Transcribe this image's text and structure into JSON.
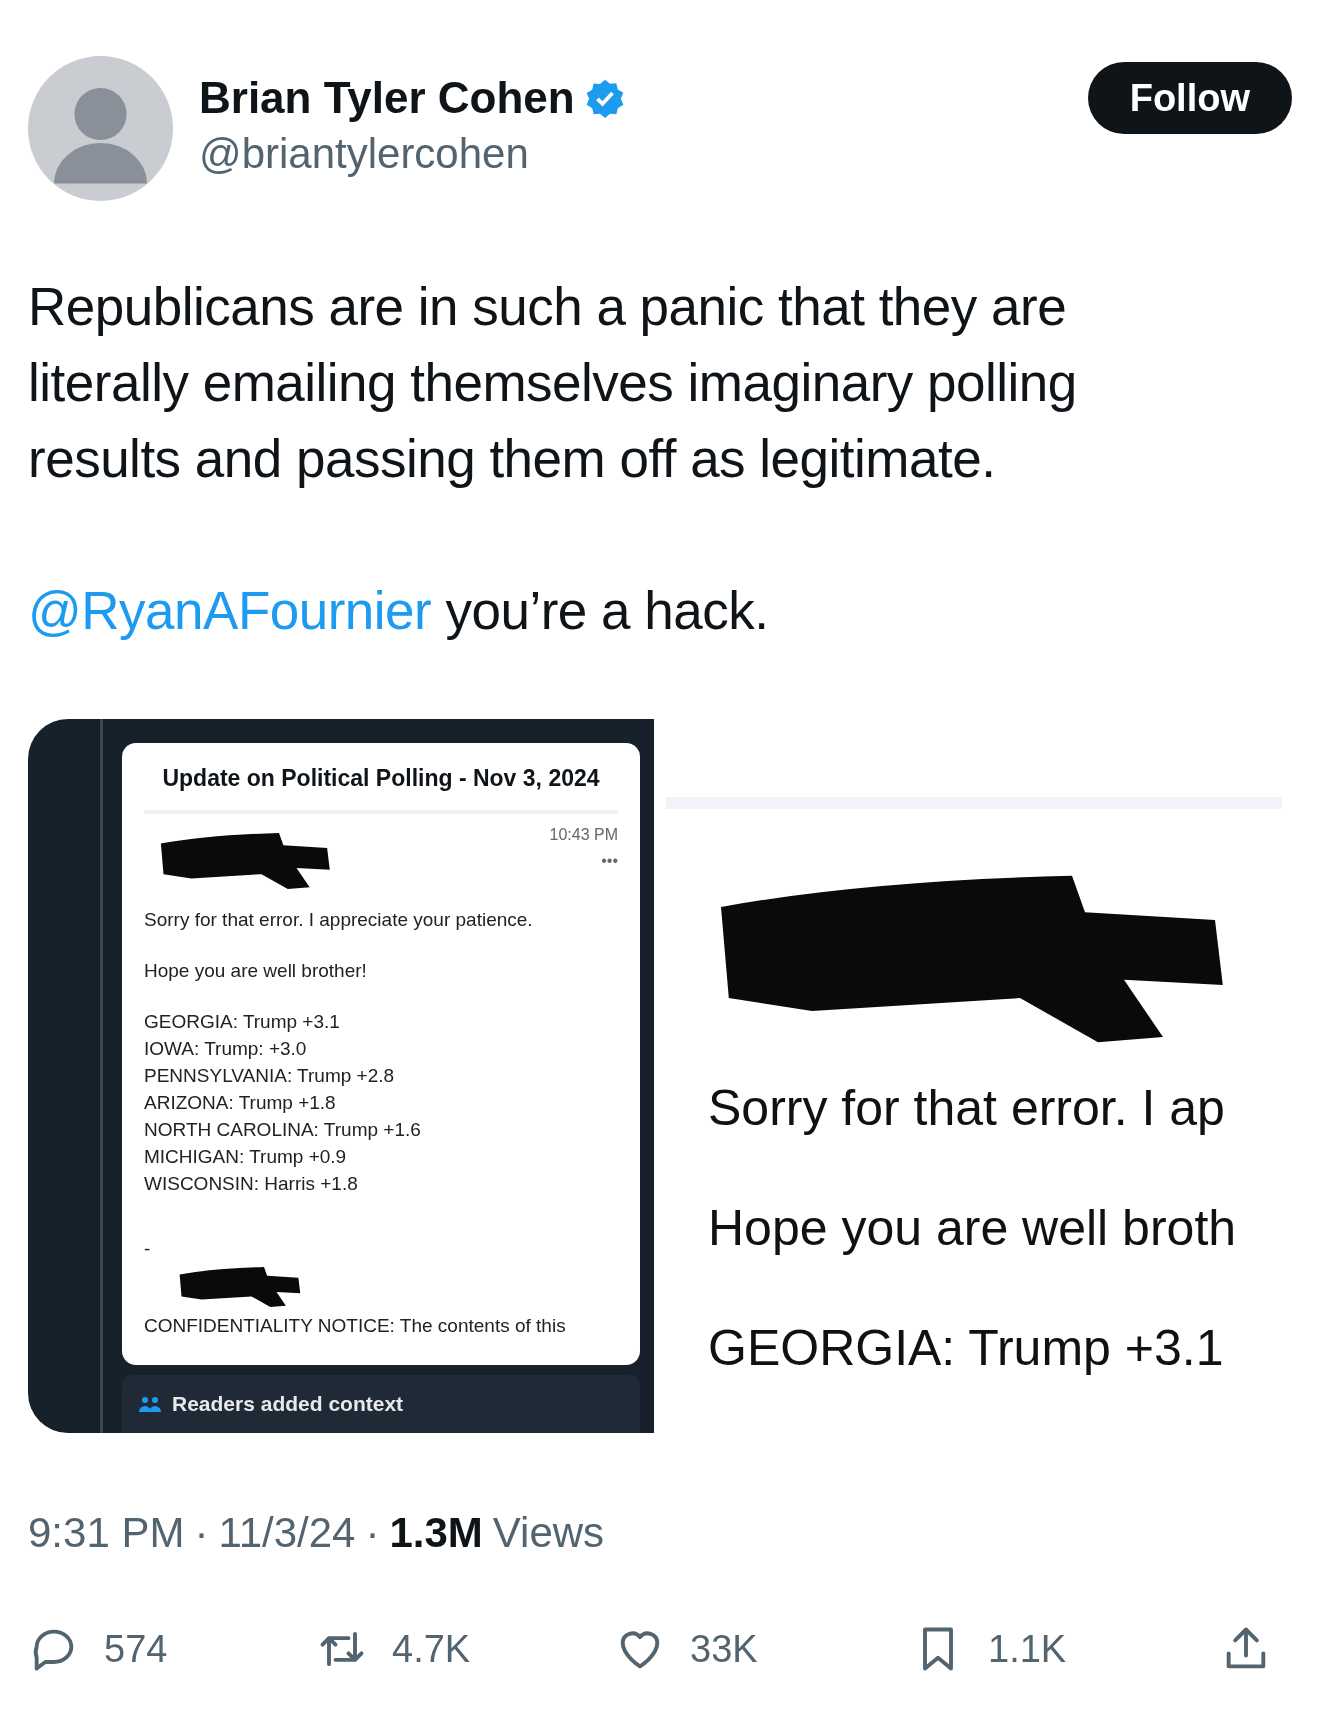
{
  "author": {
    "name": "Brian Tyler Cohen",
    "verified": true,
    "handle": "@briantylercohen"
  },
  "follow_button": {
    "label": "Follow"
  },
  "tweet": {
    "text": "Republicans are in such a panic that they are literally emailing themselves imaginary polling results and passing them off as legitimate.",
    "mention": "@RyanAFournier",
    "mention_rest": "you’re a hack."
  },
  "media": [
    {
      "kind": "email_card",
      "subject": "Update on Political Polling - Nov 3, 2024",
      "time": "10:43 PM",
      "more": "•••",
      "lines": [
        "Sorry for that error. I appreciate your patience.",
        "Hope you are well brother!"
      ],
      "results": [
        "GEORGIA: Trump +3.1",
        "IOWA: Trump: +3.0",
        "PENNSYLVANIA: Trump +2.8",
        "ARIZONA: Trump +1.8",
        "NORTH CAROLINA: Trump +1.6",
        "MICHIGAN: Trump +0.9",
        "WISCONSIN: Harris +1.8"
      ],
      "dash": "-",
      "notice": "CONFIDENTIALITY NOTICE: The contents of this",
      "context_label": "Readers added context"
    },
    {
      "kind": "email_zoom",
      "lines": [
        "Sorry for that error. I ap",
        "Hope you are well broth",
        "GEORGIA: Trump +3.1"
      ]
    }
  ],
  "meta": {
    "separator": "·",
    "time": "9:31 PM",
    "date": "11/3/24",
    "views_count": "1.3M",
    "views_label": "Views"
  },
  "actions": [
    {
      "kind": "reply",
      "count": "574"
    },
    {
      "kind": "repost",
      "count": "4.7K"
    },
    {
      "kind": "like",
      "count": "33K"
    },
    {
      "kind": "bookmark",
      "count": "1.1K"
    },
    {
      "kind": "share"
    }
  ]
}
